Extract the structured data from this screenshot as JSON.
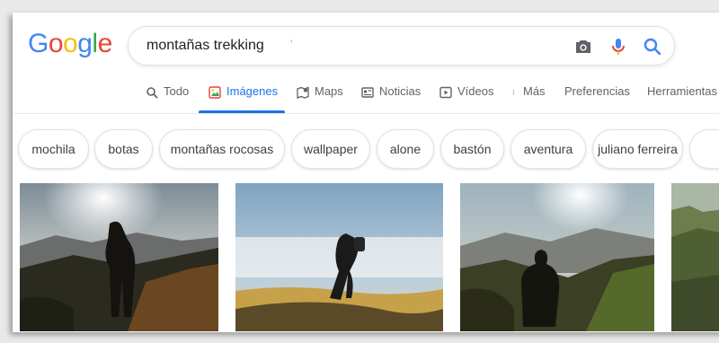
{
  "search": {
    "query": "montañas trekking"
  },
  "tabs": [
    {
      "label": "Todo"
    },
    {
      "label": "Imágenes"
    },
    {
      "label": "Maps"
    },
    {
      "label": "Noticias"
    },
    {
      "label": "Vídeos"
    },
    {
      "label": "Más"
    },
    {
      "label": "Preferencias"
    },
    {
      "label": "Herramientas"
    }
  ],
  "chips": [
    "mochila",
    "botas",
    "montañas rocosas",
    "wallpaper",
    "alone",
    "bastón",
    "aventura",
    "juliano ferreira"
  ],
  "colors": {
    "accent": "#1a73e8",
    "logo_blue": "#4285f4",
    "logo_red": "#ea4335",
    "logo_yellow": "#fbbc05",
    "logo_green": "#34a853"
  }
}
